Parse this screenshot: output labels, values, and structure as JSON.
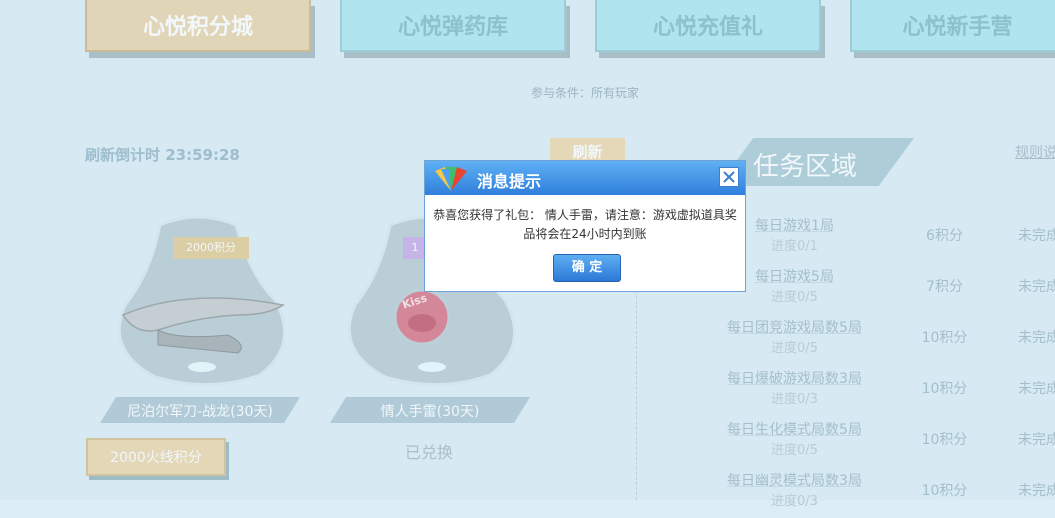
{
  "tabs": [
    {
      "label": "心悦积分城",
      "active": true
    },
    {
      "label": "心悦弹药库",
      "active": false
    },
    {
      "label": "心悦充值礼",
      "active": false
    },
    {
      "label": "心悦新手营",
      "active": false
    }
  ],
  "condition": "参与条件：所有玩家",
  "countdown": "刷新倒计时 23:59:28",
  "refresh_label": "刷新",
  "task_area": {
    "title": "任务区域",
    "rules_link": "规则说",
    "tasks": [
      {
        "name": "每日游戏1局",
        "progress": "进度0/1",
        "points": "6积分",
        "status": "未完成"
      },
      {
        "name": "每日游戏5局",
        "progress": "进度0/5",
        "points": "7积分",
        "status": "未完成"
      },
      {
        "name": "每日团竞游戏局数5局",
        "progress": "进度0/5",
        "points": "10积分",
        "status": "未完成"
      },
      {
        "name": "每日爆破游戏局数3局",
        "progress": "进度0/3",
        "points": "10积分",
        "status": "未完成"
      },
      {
        "name": "每日生化模式局数5局",
        "progress": "进度0/5",
        "points": "10积分",
        "status": "未完成"
      },
      {
        "name": "每日幽灵模式局数3局",
        "progress": "进度0/3",
        "points": "10积分",
        "status": "未完成"
      }
    ]
  },
  "items": [
    {
      "price_tag": "2000积分",
      "name": "尼泊尔军刀-战龙(30天)",
      "button": "2000火线积分"
    },
    {
      "price_tag": "1",
      "name": "情人手雷(30天)",
      "status": "已兑换",
      "badge_text": "Kiss"
    }
  ],
  "dialog": {
    "title": "消息提示",
    "message": "恭喜您获得了礼包： 情人手雷，请注意：游戏虚拟道具奖品将会在24小时内到账",
    "ok": "确 定"
  },
  "icons": {
    "close": "close-icon",
    "logo": "cf-logo-icon"
  },
  "colors": {
    "tab_active": "#e9d3a6",
    "tab_normal": "#a9e7f0",
    "dialog_header": "#3d8fe6"
  }
}
